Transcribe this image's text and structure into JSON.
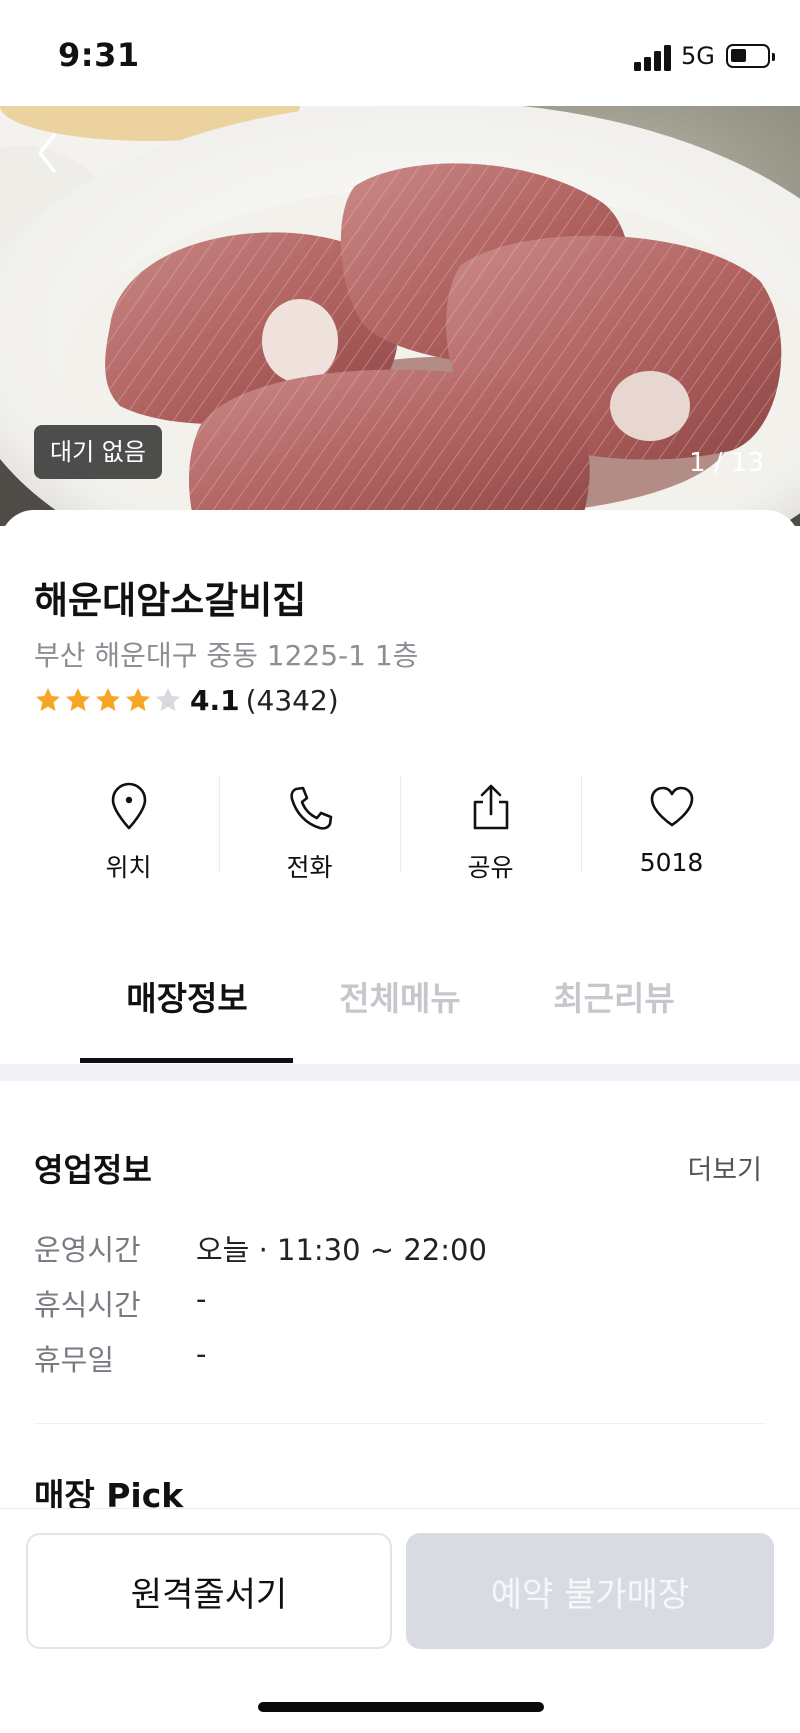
{
  "status_bar": {
    "time": "9:31",
    "network": "5G"
  },
  "hero": {
    "wait_badge": "대기 없음",
    "photo_counter": "1 / 13"
  },
  "store": {
    "name": "해운대암소갈비집",
    "address": "부산 해운대구 중동 1225-1 1층",
    "rating": "4.1",
    "rating_count": "(4342)",
    "stars_filled": 4,
    "stars_total": 5
  },
  "actions": [
    {
      "label": "위치",
      "icon": "location-pin-icon"
    },
    {
      "label": "전화",
      "icon": "phone-icon"
    },
    {
      "label": "공유",
      "icon": "share-icon"
    },
    {
      "label": "5018",
      "icon": "heart-icon"
    }
  ],
  "tabs": [
    {
      "label": "매장정보",
      "active": true
    },
    {
      "label": "전체메뉴",
      "active": false
    },
    {
      "label": "최근리뷰",
      "active": false
    }
  ],
  "business_info": {
    "title": "영업정보",
    "more": "더보기",
    "rows": [
      {
        "key": "운영시간",
        "value": "오늘 · 11:30 ~ 22:00"
      },
      {
        "key": "휴식시간",
        "value": "-"
      },
      {
        "key": "휴무일",
        "value": "-"
      }
    ]
  },
  "store_pick": {
    "title": "매장 Pick"
  },
  "bottom_bar": {
    "queue_button": "원격줄서기",
    "reserve_button": "예약 불가매장"
  },
  "colors": {
    "star": "#f6a623",
    "star_empty": "#d8d8de",
    "tab_inactive": "#c6c6cc",
    "disabled_button": "#d9dbe2"
  }
}
